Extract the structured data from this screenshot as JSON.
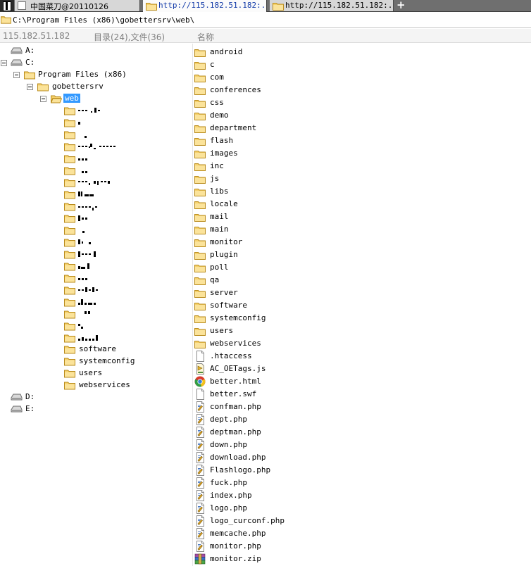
{
  "tabs": [
    {
      "label": "中国菜刀@20110126",
      "kind": "app"
    },
    {
      "label": "http://115.182.51.182:...",
      "kind": "url",
      "active": true
    },
    {
      "label": "http://115.182.51.182:...",
      "kind": "url"
    }
  ],
  "new_tab_label": "+",
  "path": "C:\\Program Files (x86)\\gobettersrv\\web\\",
  "header": {
    "host": "115.182.51.182",
    "summary": "目录(24),文件(36)",
    "name_col": "名称"
  },
  "tree": {
    "drives": [
      {
        "label": "A:"
      },
      {
        "label": "C:"
      },
      {
        "label": "D:"
      },
      {
        "label": "E:"
      }
    ],
    "program_files": "Program Files (x86)",
    "gobettersrv": "gobettersrv",
    "web": "web",
    "web_children": [
      "software",
      "systemconfig",
      "users",
      "webservices"
    ]
  },
  "files": [
    {
      "name": "android",
      "type": "folder"
    },
    {
      "name": "c",
      "type": "folder"
    },
    {
      "name": "com",
      "type": "folder"
    },
    {
      "name": "conferences",
      "type": "folder"
    },
    {
      "name": "css",
      "type": "folder"
    },
    {
      "name": "demo",
      "type": "folder"
    },
    {
      "name": "department",
      "type": "folder"
    },
    {
      "name": "flash",
      "type": "folder"
    },
    {
      "name": "images",
      "type": "folder"
    },
    {
      "name": "inc",
      "type": "folder"
    },
    {
      "name": "js",
      "type": "folder"
    },
    {
      "name": "libs",
      "type": "folder"
    },
    {
      "name": "locale",
      "type": "folder"
    },
    {
      "name": "mail",
      "type": "folder"
    },
    {
      "name": "main",
      "type": "folder"
    },
    {
      "name": "monitor",
      "type": "folder"
    },
    {
      "name": "plugin",
      "type": "folder"
    },
    {
      "name": "poll",
      "type": "folder"
    },
    {
      "name": "qa",
      "type": "folder"
    },
    {
      "name": "server",
      "type": "folder"
    },
    {
      "name": "software",
      "type": "folder"
    },
    {
      "name": "systemconfig",
      "type": "folder"
    },
    {
      "name": "users",
      "type": "folder"
    },
    {
      "name": "webservices",
      "type": "folder"
    },
    {
      "name": ".htaccess",
      "type": "file"
    },
    {
      "name": "AC_OETags.js",
      "type": "js"
    },
    {
      "name": "better.html",
      "type": "html"
    },
    {
      "name": "better.swf",
      "type": "file"
    },
    {
      "name": "confman.php",
      "type": "php"
    },
    {
      "name": "dept.php",
      "type": "php"
    },
    {
      "name": "deptman.php",
      "type": "php"
    },
    {
      "name": "down.php",
      "type": "php"
    },
    {
      "name": "download.php",
      "type": "php"
    },
    {
      "name": "Flashlogo.php",
      "type": "php"
    },
    {
      "name": "fuck.php",
      "type": "php"
    },
    {
      "name": "index.php",
      "type": "php"
    },
    {
      "name": "logo.php",
      "type": "php"
    },
    {
      "name": "logo_curconf.php",
      "type": "php"
    },
    {
      "name": "memcache.php",
      "type": "php"
    },
    {
      "name": "monitor.php",
      "type": "php"
    },
    {
      "name": "monitor.zip",
      "type": "zip"
    }
  ]
}
